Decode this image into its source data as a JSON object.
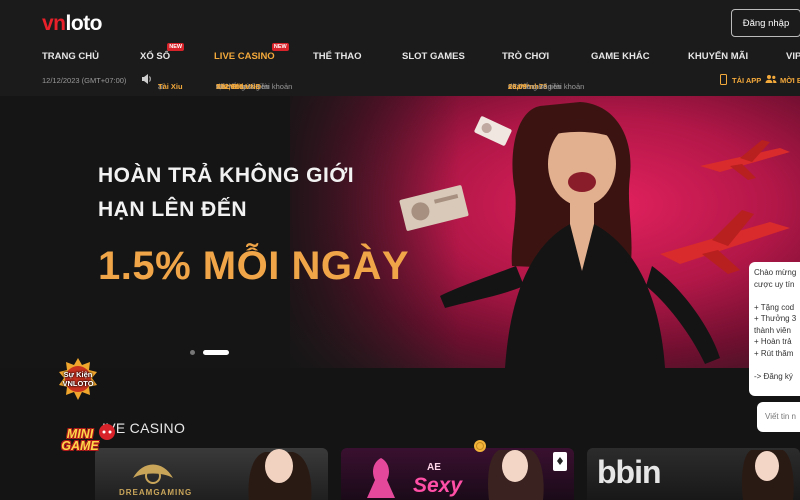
{
  "header": {
    "logo": {
      "part1": "vn",
      "part2": "loto"
    },
    "login_label": "Đăng nhập"
  },
  "nav": {
    "items": [
      {
        "label": "TRANG CHỦ",
        "badge": ""
      },
      {
        "label": "XỔ SỐ",
        "badge": "NEW"
      },
      {
        "label": "LIVE CASINO",
        "badge": "NEW",
        "active": true
      },
      {
        "label": "THỂ THAO",
        "badge": ""
      },
      {
        "label": "SLOT GAMES",
        "badge": ""
      },
      {
        "label": "TRÒ CHƠI",
        "badge": ""
      },
      {
        "label": "GAME KHÁC",
        "badge": ""
      },
      {
        "label": "KHUYẾN MÃI",
        "badge": ""
      },
      {
        "label": "VIP",
        "badge": ""
      }
    ]
  },
  "ticker": {
    "datetime": "12/12/2023 (GMT+07:00)",
    "frag_prefix": "ại",
    "frag_game": "Tài Xỉu",
    "msg1_a": "· Chúc mừng tài khoản",
    "msg1_user": "wa***ada",
    "msg1_b": "đã thắng số tiền",
    "msg1_amount": "392,000 VNĐ",
    "msg1_c": "tại",
    "msg1_game": "Xóc Đĩa",
    "msg2_a": "· Chúc mừng tài khoản",
    "msg2_user": "xua***nh73",
    "msg2_b": "đã thắng số tiền",
    "msg2_amount": "26,09",
    "app_label": "TẢI APP",
    "invite_label": "MỜI B"
  },
  "banner": {
    "line1": "HOÀN TRẢ KHÔNG GIỚI",
    "line2": "HẠN LÊN ĐẾN",
    "offer": "1.5% MỖI NGÀY"
  },
  "chat": {
    "lines": [
      "Chào mừng",
      "cược uy tín",
      "",
      "+ Tặng cod",
      "+ Thưởng 3",
      "thành viên",
      "+ Hoàn trả",
      "+ Rút thăm",
      "",
      "-> Đăng ký"
    ],
    "input_placeholder": "Viết tin n"
  },
  "promos": {
    "event_label_1": "Sự Kiện",
    "event_label_2": "VNLOTO",
    "mini_label_1": "MINI",
    "mini_label_2": "GAME"
  },
  "section": {
    "title": "IVE CASINO"
  },
  "cards": [
    {
      "brand": "DREAMGAMING"
    },
    {
      "brand": "Sexy",
      "prefix": "AE"
    },
    {
      "brand": "bbin"
    }
  ],
  "colors": {
    "accent": "#f4a93b",
    "brand_red": "#e8202a",
    "banner_magenta": "#d81f5a"
  }
}
